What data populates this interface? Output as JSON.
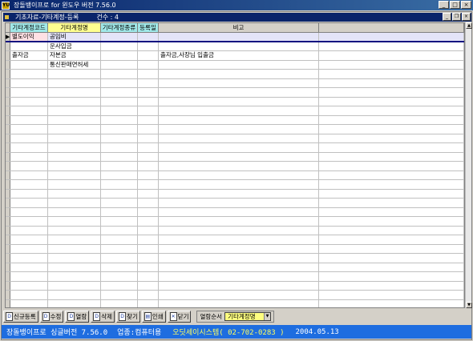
{
  "window": {
    "app_icon": "YU",
    "title": "장돌뱅이프로 for 윈도우 버전 7.56.0",
    "controls": [
      "_",
      "□",
      "×"
    ]
  },
  "child": {
    "title": "기초자료-기타계정-등록",
    "count_label": "건수 : 4",
    "controls": [
      "_",
      "❐",
      "×"
    ]
  },
  "grid": {
    "columns": [
      "기타계정코드",
      "기타계정명",
      "기타계정종류",
      "등록일",
      "비고",
      ""
    ],
    "rows": [
      [
        "별도이익",
        "공임비",
        "",
        "",
        "",
        ""
      ],
      [
        "",
        "운사입금",
        "",
        "",
        "",
        ""
      ],
      [
        "출자금",
        "자본금",
        "",
        "",
        "출자금,사장님 입출금",
        ""
      ],
      [
        "",
        "통신판매면허세",
        "",
        "",
        "",
        ""
      ]
    ],
    "empty_row_count": 27
  },
  "toolbar": {
    "buttons": [
      {
        "label": "신규등록",
        "icon": "new-document-icon"
      },
      {
        "label": "수정",
        "icon": "edit-icon"
      },
      {
        "label": "열람",
        "icon": "view-icon"
      },
      {
        "label": "삭제",
        "icon": "delete-icon"
      },
      {
        "label": "찾기",
        "icon": "search-icon"
      },
      {
        "label": "인쇄",
        "icon": "print-icon"
      },
      {
        "label": "닫기",
        "icon": "close-icon"
      }
    ],
    "sort_label": "열람순서",
    "sort_value": "기타계정명"
  },
  "status": {
    "product": "장돌뱅이프로 싱글버전 7.56.0",
    "business": "업종:컴퓨터용",
    "company": "오딧세이시스템( 02-702-0283 )",
    "date": "2004.05.13"
  },
  "colors": {
    "title_bar": "#08246b",
    "status_bar": "#1e6de0",
    "header_cyan": "#a0e8e8",
    "header_yellow": "#ffff90"
  }
}
